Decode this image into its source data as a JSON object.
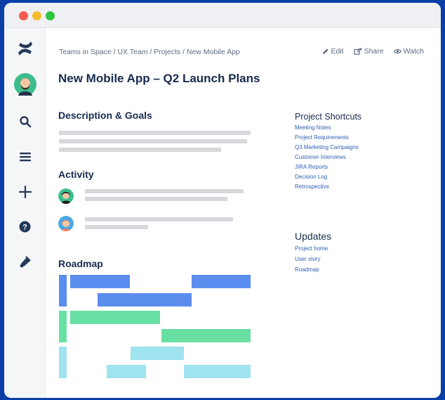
{
  "window": {
    "controls": [
      "close",
      "minimize",
      "maximize"
    ]
  },
  "sidebar": {
    "icons": [
      "confluence-logo-icon",
      "user-avatar-icon",
      "search-icon",
      "menu-icon",
      "plus-icon",
      "help-icon",
      "notifications-icon"
    ]
  },
  "breadcrumb": "Teams in Space / UX Team / Projects / New Mobile App",
  "toolbar": {
    "edit": "Edit",
    "share": "Share",
    "watch": "Watch"
  },
  "page": {
    "title": "New Mobile App – Q2 Launch Plans",
    "description_title": "Description & Goals",
    "activity_title": "Activity",
    "roadmap_title": "Roadmap"
  },
  "shortcuts": {
    "title": "Project Shortcuts",
    "links": [
      "Meeting Notes",
      "Project Requirements",
      "Q3 Marketing Campaigns",
      "Customer Interviews",
      "JIRA Reports",
      "Decision Log",
      "Retrospective"
    ]
  },
  "updates": {
    "title": "Updates",
    "links": [
      "Project home",
      "User story",
      "Roadmap"
    ]
  },
  "colors": {
    "blue": "#5b8def",
    "green": "#69e0a3",
    "cyan": "#9fe3ef",
    "link": "#2f5fb3",
    "text": "#172b4d"
  }
}
